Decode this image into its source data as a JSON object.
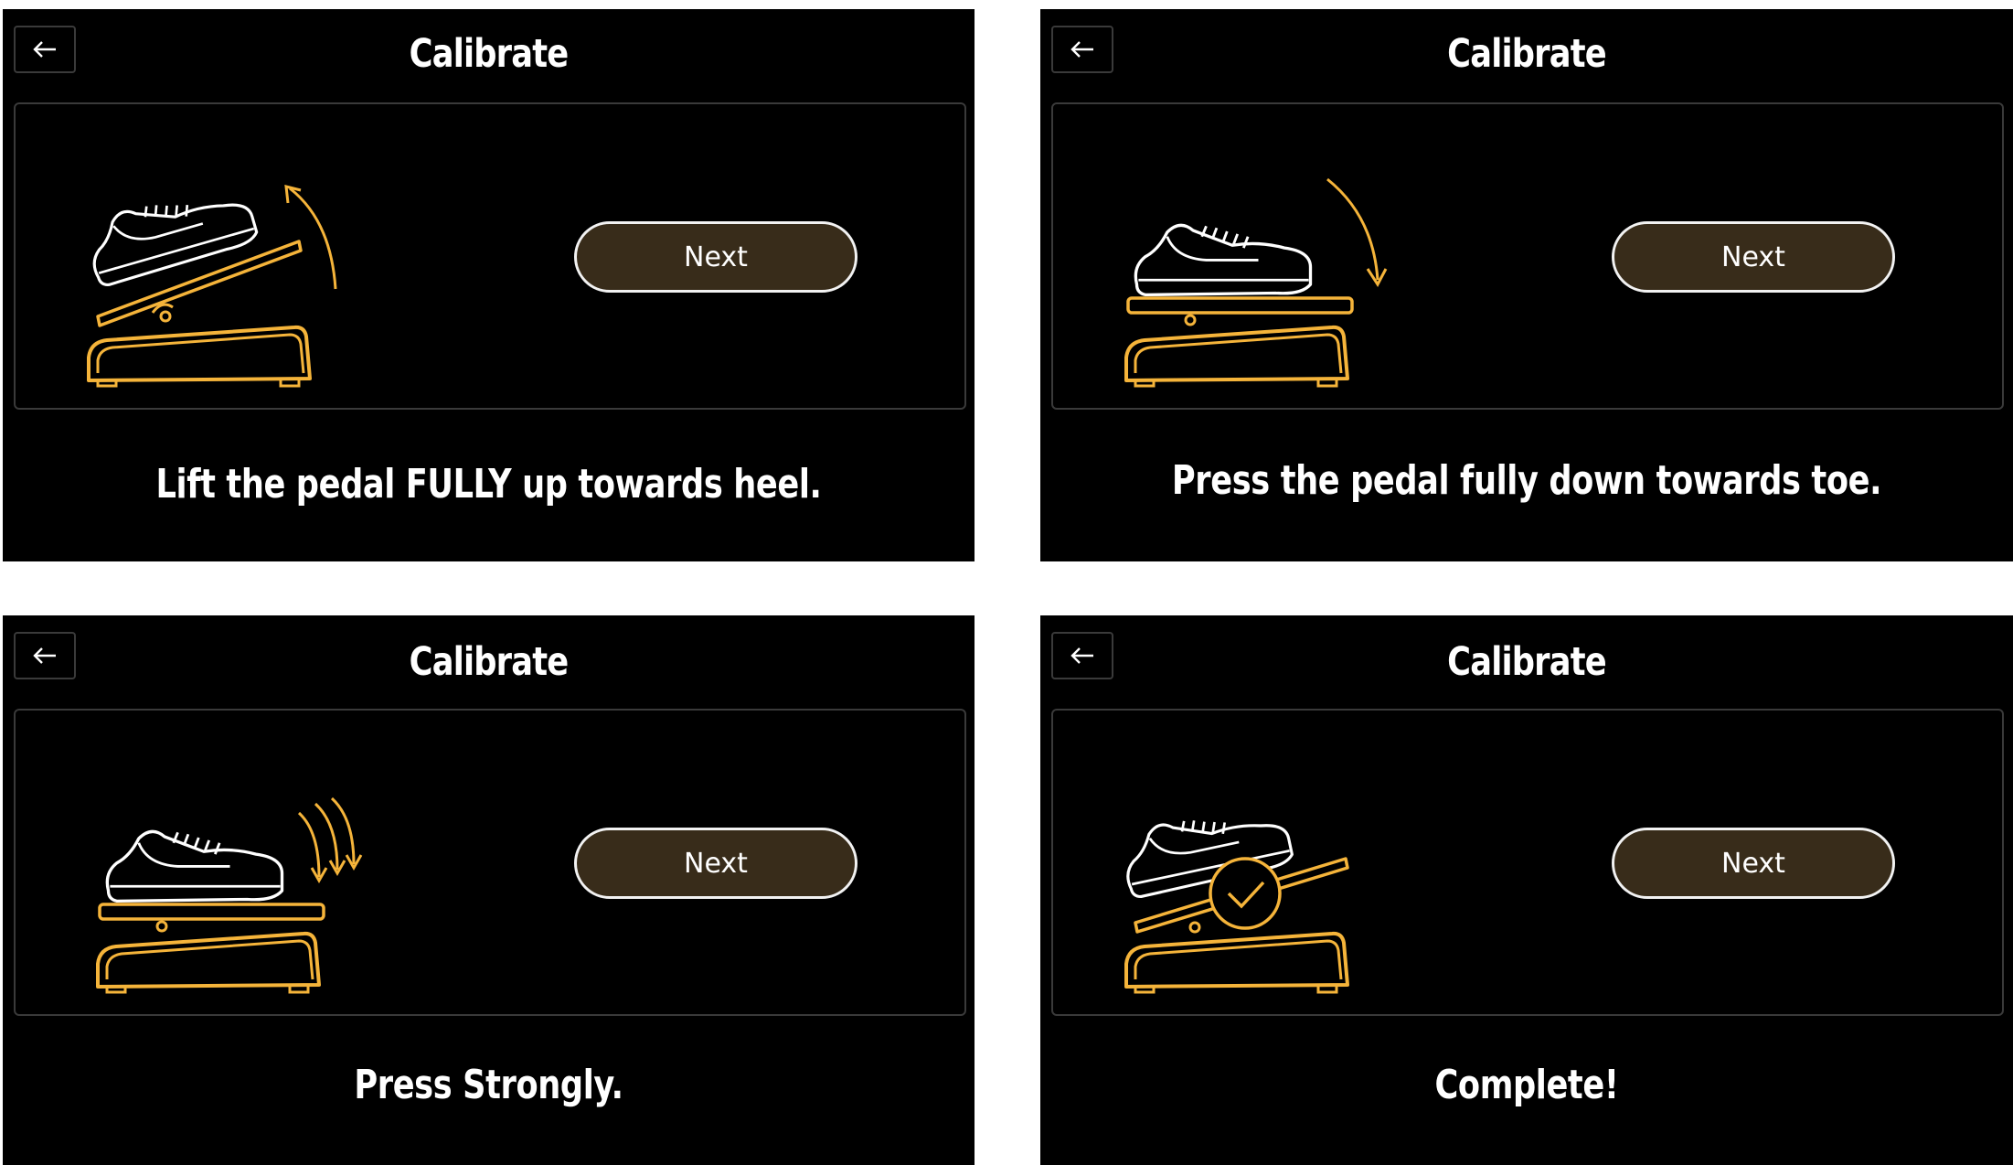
{
  "colors": {
    "accent": "#f5b43a",
    "button_bg": "#382c1a",
    "panel_border": "#3a3a3a",
    "background": "#000000"
  },
  "screens": [
    {
      "title": "Calibrate",
      "next_label": "Next",
      "instruction": "Lift the pedal FULLY up towards heel.",
      "illustration": "pedal-heel-up-icon"
    },
    {
      "title": "Calibrate",
      "next_label": "Next",
      "instruction": "Press the pedal fully down towards toe.",
      "illustration": "pedal-toe-down-icon"
    },
    {
      "title": "Calibrate",
      "next_label": "Next",
      "instruction": "Press Strongly.",
      "illustration": "pedal-press-strong-icon"
    },
    {
      "title": "Calibrate",
      "next_label": "Next",
      "instruction": "Complete!",
      "illustration": "pedal-complete-check-icon"
    }
  ]
}
